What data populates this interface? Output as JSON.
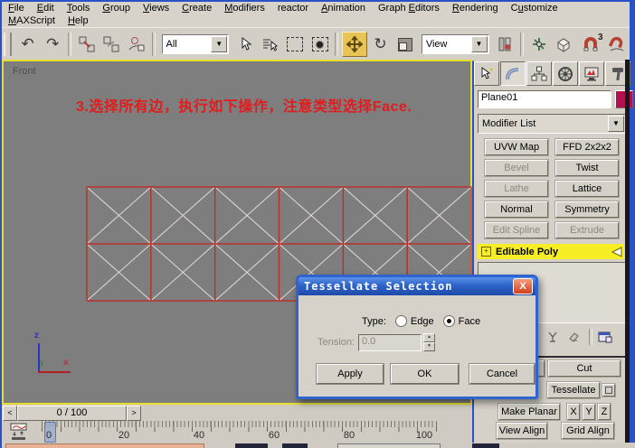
{
  "menu": {
    "row1": [
      {
        "label": "File",
        "u": 0
      },
      {
        "label": "Edit",
        "u": 0
      },
      {
        "label": "Tools",
        "u": 0
      },
      {
        "label": "Group",
        "u": 0
      },
      {
        "label": "Views",
        "u": 0
      },
      {
        "label": "Create",
        "u": 0
      },
      {
        "label": "Modifiers",
        "u": 0
      },
      {
        "label": "reactor",
        "u": -1
      },
      {
        "label": "Animation",
        "u": 0
      },
      {
        "label": "Graph Editors",
        "u": 6
      },
      {
        "label": "Rendering",
        "u": 0
      },
      {
        "label": "Customize",
        "u": 1
      }
    ],
    "row2": [
      {
        "label": "MAXScript",
        "u": 0
      },
      {
        "label": "Help",
        "u": 0
      }
    ]
  },
  "toolbar": {
    "selection_filter_value": "All",
    "coordinate_system_value": "View",
    "snap_count": "3"
  },
  "viewport": {
    "label": "Front",
    "annotation": "3.选择所有边，执行如下操作，注意类型选择Face.",
    "axis": {
      "x": "x",
      "y": "y",
      "z": "z"
    },
    "grid": {
      "cols": 6,
      "rows": 2
    }
  },
  "command_panel": {
    "object_name": "Plane01",
    "modifier_list_label": "Modifier List",
    "modifier_buttons": [
      {
        "label": "UVW Map",
        "enabled": true
      },
      {
        "label": "FFD 2x2x2",
        "enabled": true
      },
      {
        "label": "Bevel",
        "enabled": false
      },
      {
        "label": "Twist",
        "enabled": true
      },
      {
        "label": "Lathe",
        "enabled": false
      },
      {
        "label": "Lattice",
        "enabled": true
      },
      {
        "label": "Normal",
        "enabled": true
      },
      {
        "label": "Symmetry",
        "enabled": true
      },
      {
        "label": "Edit Spline",
        "enabled": false
      },
      {
        "label": "Extrude",
        "enabled": false
      }
    ],
    "stack_item": "Editable Poly",
    "edit_geometry": {
      "cut": "Cut",
      "tessellate": "Tessellate",
      "make_planar": "Make Planar",
      "axes": [
        "X",
        "Y",
        "Z"
      ],
      "view_align": "View Align",
      "grid_align": "Grid Align"
    }
  },
  "dialog": {
    "title": "Tessellate Selection",
    "close": "X",
    "type_label": "Type:",
    "type_options": [
      {
        "label": "Edge",
        "selected": false
      },
      {
        "label": "Face",
        "selected": true
      }
    ],
    "tension_label": "Tension:",
    "tension_value": "0.0",
    "buttons": [
      "Apply",
      "OK",
      "Cancel"
    ]
  },
  "timeline": {
    "frame_display": "0 / 100",
    "prev_label": "<",
    "next_label": ">",
    "tick_labels": [
      "0",
      "20",
      "40",
      "60",
      "80",
      "100"
    ]
  },
  "colors": {
    "window_border": "#2a52c8",
    "viewport_bg": "#7e7e7e",
    "active_viewport_border": "#e6df2e",
    "selected_edge": "#b83028",
    "hidden_edge": "#ded5d5",
    "annotation_red": "#e11c1c",
    "stack_highlight": "#f7ee26",
    "object_color": "#b31050"
  }
}
